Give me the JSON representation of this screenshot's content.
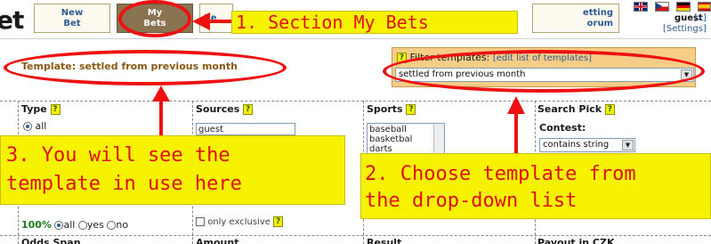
{
  "header": {
    "logo_fragment": "et",
    "nav": [
      {
        "line1": "New",
        "line2": "Bet"
      },
      {
        "line1": "My",
        "line2": "Bets"
      },
      {
        "line1": "Re",
        "line2": ""
      },
      {
        "line1": "etting",
        "line2": "orum"
      }
    ],
    "user": {
      "name": "guest",
      "close": "[x]",
      "settings": "[Settings]"
    }
  },
  "template": {
    "label": "Template: settled from previous month"
  },
  "filter": {
    "help": "?",
    "title": "Filter templates:",
    "edit_link": "[edit list of templates]",
    "selected": "settled from previous month"
  },
  "grid": {
    "columns": {
      "type": "Type",
      "sources": "Sources",
      "sports": "Sports",
      "search_pick": "Search Pick"
    },
    "type_options": {
      "all": "all"
    },
    "sources_list": [
      "guest"
    ],
    "sports_list": [
      "baseball",
      "basketbal",
      "darts"
    ],
    "contest_label": "Contest:",
    "contest_select": "contains string",
    "pct_label": "100%",
    "pct_options": [
      "all",
      "yes",
      "no"
    ],
    "only_exclusive": "only exclusive",
    "bottom_headers": [
      "Odds Span",
      "Amount",
      "Result",
      "Payout in CZK"
    ]
  },
  "annotations": {
    "step1": "1. Section My Bets",
    "step2_line1": "2. Choose template from",
    "step2_line2": "the drop-down list",
    "step3_line1": "3. You will see the",
    "step3_line2": "template in use here"
  },
  "colors": {
    "annotation_red": "#ee1111",
    "callout_yellow": "#f7f200",
    "filter_box": "#f6cd86",
    "active_tab": "#8a7350",
    "link_blue": "#2d5a93"
  }
}
